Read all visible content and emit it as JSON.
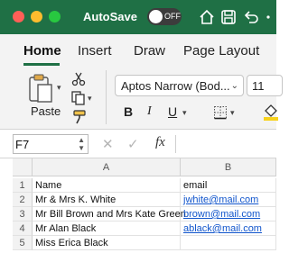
{
  "titlebar": {
    "autosave_label": "AutoSave",
    "autosave_state": "OFF",
    "colors": {
      "bar": "#1f7045"
    }
  },
  "tabs": [
    {
      "label": "Home",
      "active": true
    },
    {
      "label": "Insert"
    },
    {
      "label": "Draw"
    },
    {
      "label": "Page Layout"
    }
  ],
  "ribbon": {
    "paste_label": "Paste",
    "font_name": "Aptos Narrow (Bod...",
    "font_size": "11",
    "bold": "B",
    "italic": "I",
    "underline": "U",
    "icons": [
      "paste-icon",
      "cut-icon",
      "copy-icon",
      "format-painter-icon",
      "borders-icon",
      "fill-color-icon"
    ]
  },
  "formula_bar": {
    "name_box": "F7",
    "fx": "fx",
    "content": ""
  },
  "sheet": {
    "columns": [
      "A",
      "B"
    ],
    "rows": [
      {
        "num": "1",
        "a": "Name",
        "b": "email"
      },
      {
        "num": "2",
        "a": "Mr & Mrs K. White",
        "b": "jwhite@mail.com"
      },
      {
        "num": "3",
        "a": "Mr Bill Brown and Mrs Kate Green",
        "b": "brown@mail.com"
      },
      {
        "num": "4",
        "a": "Mr Alan Black",
        "b": "ablack@mail.com"
      },
      {
        "num": "5",
        "a": "Miss Erica Black",
        "b": ""
      }
    ]
  }
}
